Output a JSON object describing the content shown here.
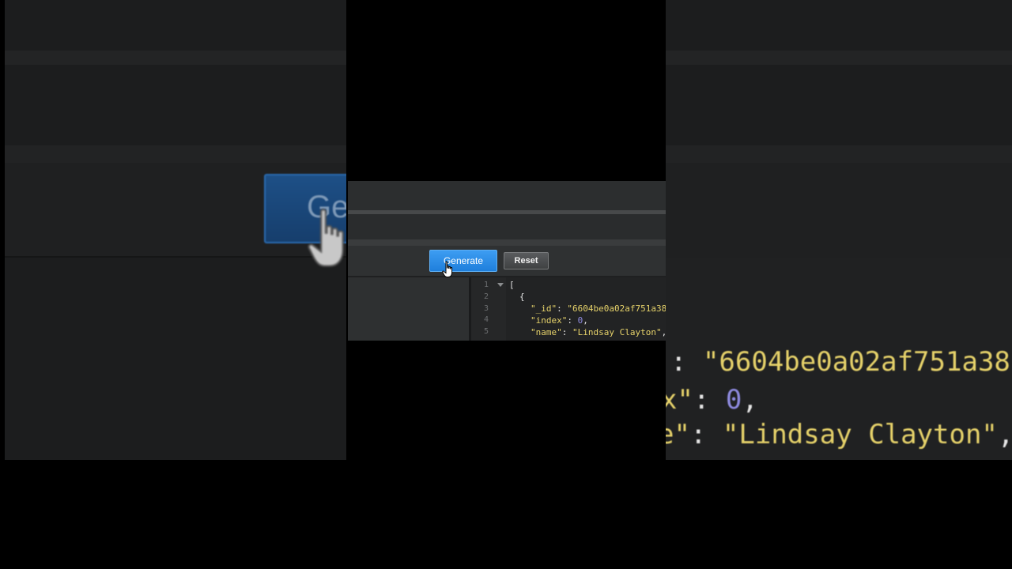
{
  "toolbar": {
    "generate_label": "Generate",
    "reset_label": "Reset"
  },
  "backdrop": {
    "zoomed_button_text": "Ge",
    "zoom_line_1": {
      "punc": ": ",
      "value": "\"6604be0a02af751a38"
    },
    "zoom_line_2": {
      "key": "x\"",
      "punc": ": ",
      "num": "0",
      "tail": ","
    },
    "zoom_line_3": {
      "key": "e\"",
      "punc": ": ",
      "value": "\"Lindsay Clayton\"",
      "tail": ","
    }
  },
  "editor": {
    "line_numbers": [
      "1",
      "2",
      "3",
      "4",
      "5"
    ],
    "lines": [
      {
        "text": "["
      },
      {
        "text": "{"
      },
      {
        "key": "\"_id\"",
        "punc": ": ",
        "value": "\"6604be0a02af751a38"
      },
      {
        "key": "\"index\"",
        "punc": ": ",
        "num": "0",
        "tail": ","
      },
      {
        "key": "\"name\"",
        "punc": ": ",
        "value": "\"Lindsay Clayton\"",
        "tail": ","
      }
    ]
  },
  "colors": {
    "generate_button": "#2b8be6",
    "json_key": "#e6d26a",
    "json_number": "#8f8be0",
    "editor_bg": "#222324"
  }
}
